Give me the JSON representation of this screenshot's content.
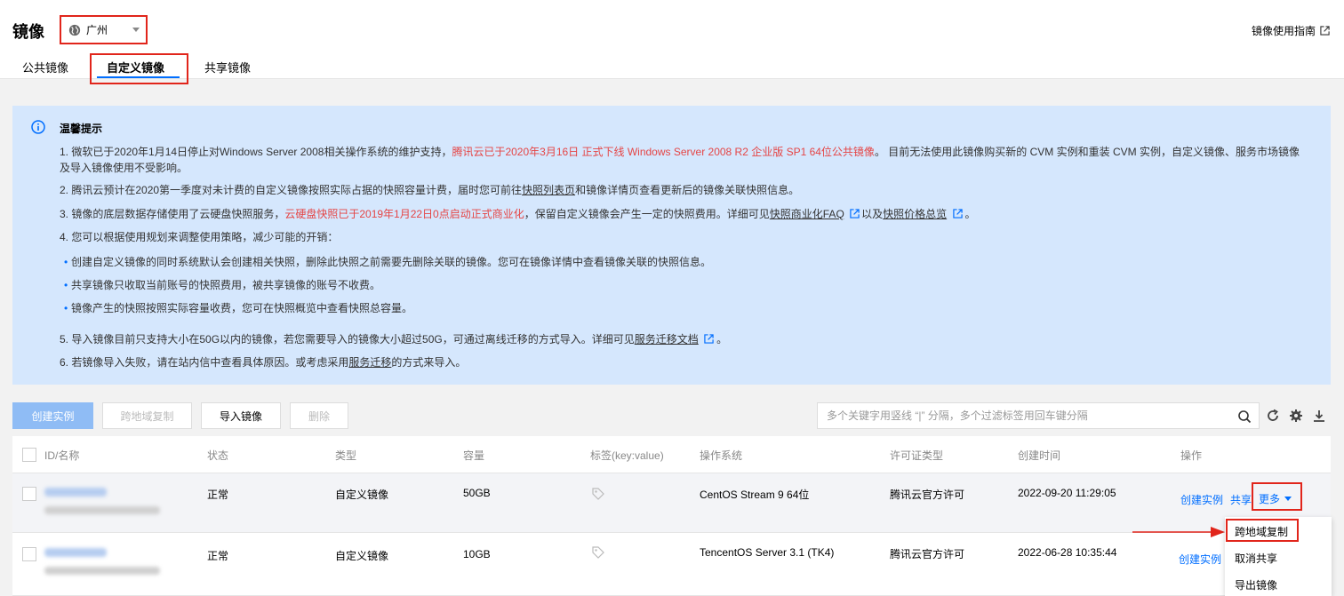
{
  "header": {
    "title": "镜像",
    "region": "广州",
    "guide_link": "镜像使用指南"
  },
  "tabs": [
    {
      "label": "公共镜像",
      "active": false
    },
    {
      "label": "自定义镜像",
      "active": true
    },
    {
      "label": "共享镜像",
      "active": false
    }
  ],
  "notice": {
    "title": "温馨提示",
    "line1_a": "1. 微软已于2020年1月14日停止对Windows Server 2008相关操作系统的维护支持，",
    "line1_red": "腾讯云已于2020年3月16日 正式下线 Windows Server 2008 R2 企业版 SP1 64位公共镜像",
    "line1_b": "。 目前无法使用此镜像购买新的 CVM 实例和重装 CVM 实例，自定义镜像、服务市场镜像及导入镜像使用不受影响。",
    "line2_a": "2. 腾讯云预计在2020第一季度对未计费的自定义镜像按照实际占据的快照容量计费，届时您可前往",
    "line2_link": "快照列表页",
    "line2_b": "和镜像详情页查看更新后的镜像关联快照信息。",
    "line3_a": "3. 镜像的底层数据存储使用了云硬盘快照服务，",
    "line3_red": "云硬盘快照已于2019年1月22日0点启动正式商业化",
    "line3_b": "，保留自定义镜像会产生一定的快照费用。详细可见",
    "line3_link1": "快照商业化FAQ",
    "line3_c": "以及",
    "line3_link2": "快照价格总览",
    "line3_d": "。",
    "line4": "4. 您可以根据使用规划来调整使用策略，减少可能的开销：",
    "bullet1": "创建自定义镜像的同时系统默认会创建相关快照，删除此快照之前需要先删除关联的镜像。您可在镜像详情中查看镜像关联的快照信息。",
    "bullet2": "共享镜像只收取当前账号的快照费用，被共享镜像的账号不收费。",
    "bullet3": "镜像产生的快照按照实际容量收费，您可在快照概览中查看快照总容量。",
    "line5_a": "5. 导入镜像目前只支持大小在50G以内的镜像，若您需要导入的镜像大小超过50G，可通过离线迁移的方式导入。详细可见",
    "line5_link": "服务迁移文档",
    "line5_b": "。",
    "line6_a": "6. 若镜像导入失败，请在站内信中查看具体原因。或考虑采用",
    "line6_link": "服务迁移",
    "line6_b": "的方式来导入。"
  },
  "toolbar": {
    "create_instance": "创建实例",
    "cross_region_copy": "跨地域复制",
    "import_image": "导入镜像",
    "delete": "删除",
    "search_placeholder": "多个关键字用竖线 “|” 分隔，多个过滤标签用回车键分隔"
  },
  "table": {
    "columns": [
      "ID/名称",
      "状态",
      "类型",
      "容量",
      "标签(key:value)",
      "操作系统",
      "许可证类型",
      "创建时间",
      "操作"
    ],
    "rows": [
      {
        "status": "正常",
        "type": "自定义镜像",
        "size": "50GB",
        "os": "CentOS Stream 9 64位",
        "license": "腾讯云官方许可",
        "created": "2022-09-20 11:29:05",
        "op_create": "创建实例",
        "op_share": "共享",
        "op_more": "更多"
      },
      {
        "status": "正常",
        "type": "自定义镜像",
        "size": "10GB",
        "os": "TencentOS Server 3.1 (TK4)",
        "license": "腾讯云官方许可",
        "created": "2022-06-28 10:35:44",
        "op_create": "创建实例"
      }
    ]
  },
  "dropdown": {
    "items": [
      "跨地域复制",
      "取消共享",
      "导出镜像"
    ]
  },
  "colors": {
    "accent": "#006eff",
    "highlight": "#e1251b",
    "notice_bg": "#d5e7fd",
    "warning_text": "#e54545"
  }
}
